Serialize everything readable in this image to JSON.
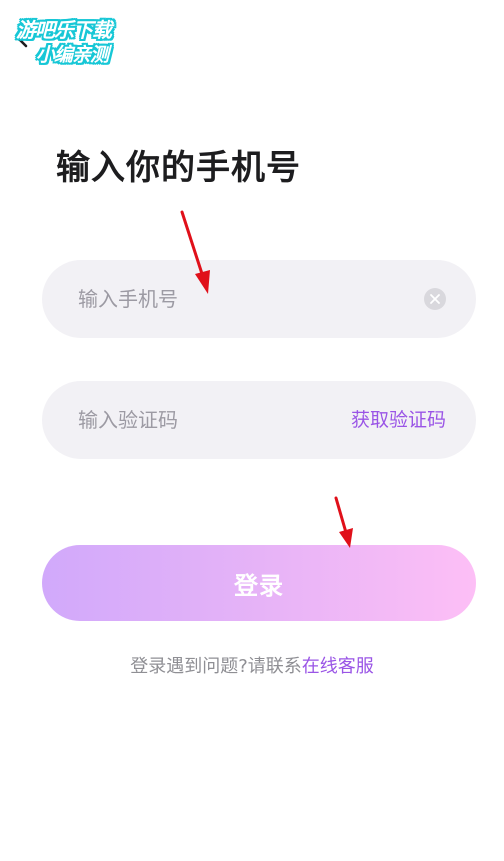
{
  "watermark": {
    "line1": "游吧乐下载",
    "line2": "小编亲测"
  },
  "page_title": "输入你的手机号",
  "phone_field": {
    "placeholder": "输入手机号",
    "value": ""
  },
  "code_field": {
    "placeholder": "输入验证码",
    "value": "",
    "get_code_label": "获取验证码"
  },
  "login_button_label": "登录",
  "help": {
    "prefix": "登录遇到问题?请联系",
    "link": "在线客服"
  },
  "colors": {
    "accent": "#9a55e6",
    "field_bg": "#f2f1f5",
    "button_gradient_start": "#d1a9fb",
    "button_gradient_end": "#fdbff6",
    "annotation_arrow": "#e0101a",
    "watermark_outline": "#17c7d6"
  },
  "icons": {
    "back": "chevron-left-icon",
    "clear": "clear-circle-icon",
    "annotation": "red-arrow-icon"
  }
}
